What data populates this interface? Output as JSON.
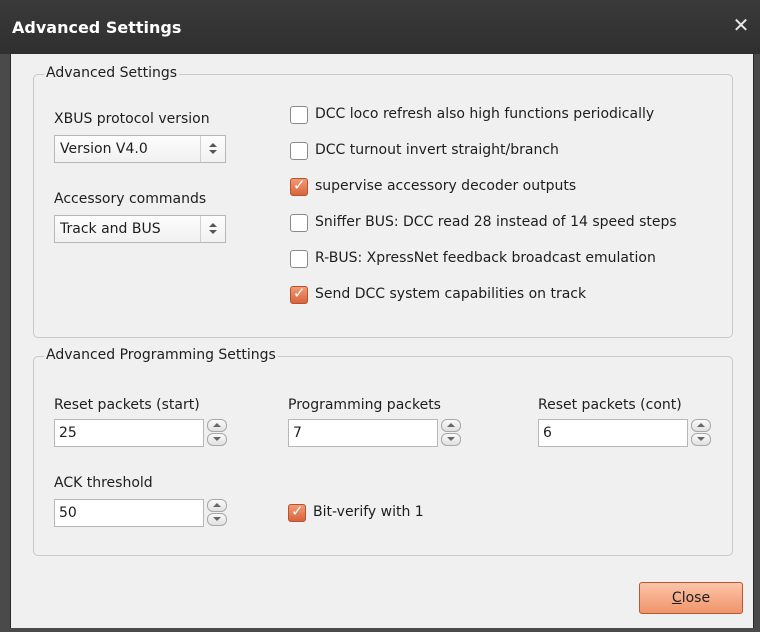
{
  "window": {
    "title": "Advanced Settings",
    "close_glyph": "✕"
  },
  "advanced": {
    "group_title": "Advanced Settings",
    "xbus_label": "XBUS protocol version",
    "xbus_value": "Version V4.0",
    "accessory_label": "Accessory commands",
    "accessory_value": "Track and BUS",
    "checks": [
      {
        "label": "DCC loco refresh also high functions periodically",
        "checked": false
      },
      {
        "label": "DCC turnout invert straight/branch",
        "checked": false
      },
      {
        "label": "supervise accessory decoder outputs",
        "checked": true
      },
      {
        "label": "Sniffer BUS: DCC read 28 instead of 14 speed steps",
        "checked": false
      },
      {
        "label": "R-BUS: XpressNet feedback broadcast emulation",
        "checked": false
      },
      {
        "label": "Send DCC system capabilities on track",
        "checked": true
      }
    ]
  },
  "programming": {
    "group_title": "Advanced Programming Settings",
    "reset_start_label": "Reset packets (start)",
    "reset_start_value": "25",
    "prog_packets_label": "Programming packets",
    "prog_packets_value": "7",
    "reset_cont_label": "Reset packets (cont)",
    "reset_cont_value": "6",
    "ack_label": "ACK threshold",
    "ack_value": "50",
    "bit_verify_label": "Bit-verify with 1",
    "bit_verify_checked": true
  },
  "footer": {
    "close_first": "C",
    "close_rest": "lose"
  },
  "colors": {
    "accent_orange": "#f0946b",
    "title_bar": "#333333",
    "panel": "#f0f0f0"
  }
}
